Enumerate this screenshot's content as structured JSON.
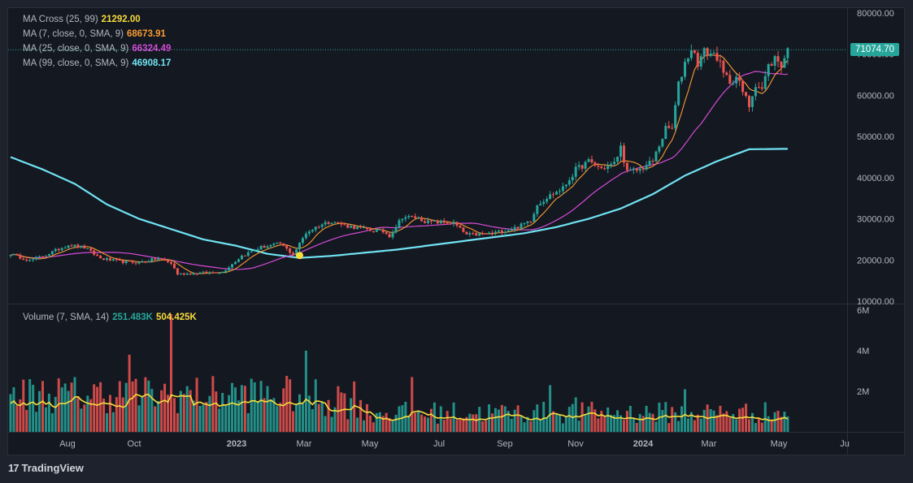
{
  "legend": {
    "ma_cross": {
      "label": "MA Cross (25, 99)",
      "value": "21292.00",
      "color": "#f7dc3c"
    },
    "ma7": {
      "label": "MA (7, close, 0, SMA, 9)",
      "value": "68673.91",
      "color": "#f89b33"
    },
    "ma25": {
      "label": "MA (25, close, 0, SMA, 9)",
      "value": "66324.49",
      "color": "#d44bd6"
    },
    "ma99": {
      "label": "MA (99, close, 0, SMA, 9)",
      "value": "46908.17",
      "color": "#70e3f2"
    },
    "volume": {
      "label": "Volume (7, SMA, 14)",
      "value1": "251.483K",
      "value2": "504.425K",
      "value1_color": "#26a69a",
      "value2_color": "#f7dc3c"
    }
  },
  "price_tag": "71074.70",
  "colors": {
    "up": "#26a69a",
    "down": "#ef5350",
    "ma7": "#f89b33",
    "ma25": "#d44bd6",
    "ma99": "#70e3f2",
    "vol_sma": "#f7dc3c",
    "cross_marker": "#f7dc3c"
  },
  "chart_data": {
    "type": "candlestick",
    "x_labels": [
      "Aug",
      "Oct",
      "2023",
      "Mar",
      "May",
      "Jul",
      "Sep",
      "Nov",
      "2024",
      "Mar",
      "May",
      "Ju"
    ],
    "price_axis": {
      "ticks": [
        "80000.00",
        "70000.00",
        "60000.00",
        "50000.00",
        "40000.00",
        "30000.00",
        "20000.00",
        "10000.00"
      ],
      "ylim": [
        10000,
        80000
      ]
    },
    "volume_axis": {
      "ticks": [
        "6M",
        "4M",
        "2M"
      ],
      "ylim": [
        0,
        6000000
      ]
    },
    "close_anchors": [
      [
        0,
        21500
      ],
      [
        6,
        19800
      ],
      [
        12,
        21600
      ],
      [
        18,
        23700
      ],
      [
        23,
        23000
      ],
      [
        28,
        20400
      ],
      [
        34,
        19600
      ],
      [
        40,
        19400
      ],
      [
        46,
        20400
      ],
      [
        50,
        19200
      ],
      [
        52,
        16600
      ],
      [
        58,
        16800
      ],
      [
        66,
        17100
      ],
      [
        72,
        21000
      ],
      [
        78,
        23100
      ],
      [
        84,
        24000
      ],
      [
        88,
        21300
      ],
      [
        92,
        26600
      ],
      [
        96,
        28400
      ],
      [
        100,
        29500
      ],
      [
        104,
        28400
      ],
      [
        108,
        27800
      ],
      [
        112,
        27200
      ],
      [
        116,
        26900
      ],
      [
        118,
        25900
      ],
      [
        122,
        30500
      ],
      [
        126,
        30300
      ],
      [
        130,
        29200
      ],
      [
        134,
        29200
      ],
      [
        138,
        28900
      ],
      [
        142,
        26100
      ],
      [
        146,
        26200
      ],
      [
        150,
        26500
      ],
      [
        154,
        27200
      ],
      [
        158,
        28000
      ],
      [
        162,
        29700
      ],
      [
        164,
        33500
      ],
      [
        168,
        35700
      ],
      [
        172,
        37400
      ],
      [
        176,
        41900
      ],
      [
        180,
        43900
      ],
      [
        184,
        42200
      ],
      [
        188,
        43400
      ],
      [
        190,
        47400
      ],
      [
        192,
        41300
      ],
      [
        196,
        42000
      ],
      [
        200,
        44000
      ],
      [
        204,
        51800
      ],
      [
        206,
        52000
      ],
      [
        208,
        62500
      ],
      [
        210,
        68000
      ],
      [
        212,
        71500
      ],
      [
        214,
        68000
      ],
      [
        216,
        70500
      ],
      [
        218,
        70200
      ],
      [
        220,
        69500
      ],
      [
        222,
        65000
      ],
      [
        224,
        63500
      ],
      [
        226,
        64500
      ],
      [
        228,
        60800
      ],
      [
        230,
        57500
      ],
      [
        232,
        63000
      ],
      [
        234,
        61500
      ],
      [
        236,
        67000
      ],
      [
        238,
        69000
      ],
      [
        240,
        67500
      ],
      [
        242,
        71000
      ]
    ],
    "ma99_anchors": [
      [
        0,
        45000
      ],
      [
        10,
        42000
      ],
      [
        20,
        38500
      ],
      [
        30,
        33500
      ],
      [
        40,
        30000
      ],
      [
        50,
        27500
      ],
      [
        60,
        25000
      ],
      [
        70,
        23500
      ],
      [
        80,
        21500
      ],
      [
        90,
        20500
      ],
      [
        100,
        21000
      ],
      [
        120,
        22500
      ],
      [
        140,
        24500
      ],
      [
        160,
        26500
      ],
      [
        170,
        28000
      ],
      [
        180,
        30000
      ],
      [
        190,
        32500
      ],
      [
        200,
        36000
      ],
      [
        210,
        40500
      ],
      [
        220,
        44000
      ],
      [
        230,
        46900
      ],
      [
        242,
        47000
      ]
    ],
    "ma_cross_point": {
      "bar": 90,
      "price": 21292.0
    },
    "last_price": 71074.7
  }
}
